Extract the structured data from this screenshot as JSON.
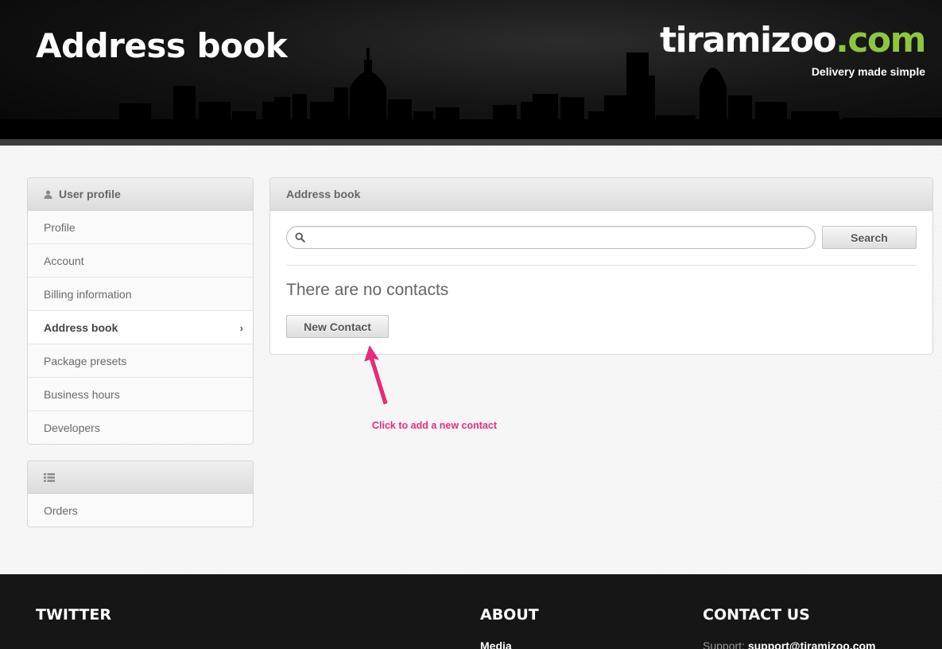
{
  "header": {
    "title": "Address book",
    "logo_brand": "tiramizoo",
    "logo_tld": ".com",
    "tagline": "Delivery made simple"
  },
  "sidebar": {
    "profile_panel": {
      "heading": "User profile",
      "heading_icon": "user-icon",
      "items": [
        {
          "label": "Profile",
          "active": false
        },
        {
          "label": "Account",
          "active": false
        },
        {
          "label": "Billing information",
          "active": false
        },
        {
          "label": "Address book",
          "active": true
        },
        {
          "label": "Package presets",
          "active": false
        },
        {
          "label": "Business hours",
          "active": false
        },
        {
          "label": "Developers",
          "active": false
        }
      ]
    },
    "orders_panel": {
      "heading_icon": "list-icon",
      "items": [
        {
          "label": "Orders"
        }
      ]
    }
  },
  "main": {
    "heading": "Address book",
    "search": {
      "value": "",
      "placeholder": "",
      "button_label": "Search"
    },
    "empty_message": "There are no contacts",
    "new_contact_label": "New Contact"
  },
  "annotation": {
    "text": "Click to add a new contact",
    "color": "#ee2a7b"
  },
  "footer": {
    "twitter_heading": "TWITTER",
    "about_heading": "ABOUT",
    "about_link": "Media",
    "contact_heading": "CONTACT US",
    "support_label": "Support:",
    "support_email": "support@tiramizoo.com"
  },
  "colors": {
    "brand_green": "#8dc63f",
    "annotation_pink": "#ee2a7b",
    "footer_bg": "#161616"
  }
}
